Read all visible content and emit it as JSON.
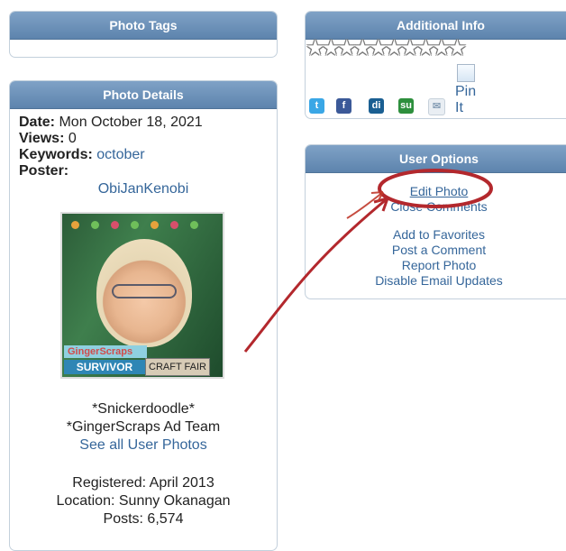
{
  "panels": {
    "tags": {
      "title": "Photo Tags"
    },
    "details": {
      "title": "Photo Details",
      "date_label": "Date:",
      "date_value": "Mon October 18, 2021",
      "views_label": "Views:",
      "views_value": "0",
      "keywords_label": "Keywords:",
      "keywords_value": "october",
      "poster_label": "Poster:",
      "poster_name": "ObiJanKenobi",
      "photo_text": {
        "banner1": "GingerScraps",
        "banner2": "SURVIVOR",
        "banner3": "CRAFT FAIR"
      },
      "title_line1": "*Snickerdoodle*",
      "title_line2": "*GingerScraps Ad Team",
      "see_all": "See all User Photos",
      "registered": "Registered: April 2013",
      "location": "Location: Sunny Okanagan",
      "posts": "Posts: 6,574"
    },
    "additional": {
      "title": "Additional Info",
      "stars_count": 10,
      "stars_text": "★★★★★★★★★★",
      "social_icons": [
        "twitter-icon",
        "facebook-icon",
        "digg-icon",
        "stumbleupon-icon",
        "email-icon"
      ],
      "pin_line1": "Pin",
      "pin_line2": "It"
    },
    "user_options": {
      "title": "User Options",
      "items": [
        "Edit Photo",
        "Close Comments",
        "Add to Favorites",
        "Post a Comment",
        "Report Photo",
        "Disable Email Updates"
      ]
    }
  },
  "colors": {
    "header_top": "#7fa2c6",
    "header_bottom": "#5d84ad",
    "link": "#35669a",
    "annotation": "#b3282d"
  }
}
